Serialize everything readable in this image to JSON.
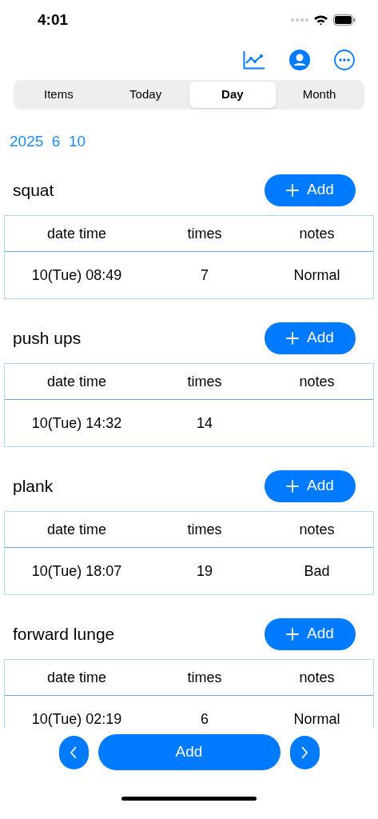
{
  "status_bar": {
    "time": "4:01"
  },
  "tabs": [
    {
      "label": "Items",
      "selected": false
    },
    {
      "label": "Today",
      "selected": false
    },
    {
      "label": "Day",
      "selected": true
    },
    {
      "label": "Month",
      "selected": false
    }
  ],
  "date": "2025  6  10",
  "sections": [
    {
      "title": "squat",
      "add_button": "Add",
      "columns": [
        "date time",
        "times",
        "notes"
      ],
      "rows": [
        [
          "10(Tue) 08:49",
          "7",
          "Normal"
        ]
      ]
    },
    {
      "title": "push ups",
      "add_button": "Add",
      "columns": [
        "date time",
        "times",
        "notes"
      ],
      "rows": [
        [
          "10(Tue) 14:32",
          "14",
          ""
        ]
      ]
    },
    {
      "title": "plank",
      "add_button": "Add",
      "columns": [
        "date time",
        "times",
        "notes"
      ],
      "rows": [
        [
          "10(Tue) 18:07",
          "19",
          "Bad"
        ]
      ]
    },
    {
      "title": "forward lunge",
      "add_button": "Add",
      "columns": [
        "date time",
        "times",
        "notes"
      ],
      "rows": [
        [
          "10(Tue) 02:19",
          "6",
          "Normal"
        ]
      ]
    }
  ],
  "bottom_bar": {
    "add_button": "Add"
  }
}
